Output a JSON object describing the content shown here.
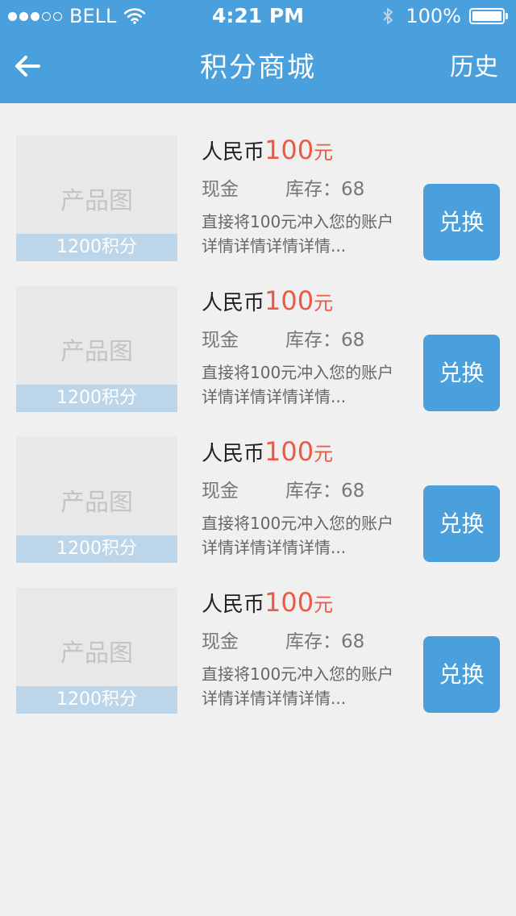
{
  "status_bar": {
    "carrier": "BELL",
    "time": "4:21 PM",
    "battery": "100%"
  },
  "nav": {
    "title": "积分商城",
    "history": "历史"
  },
  "items": [
    {
      "thumb_label": "产品图",
      "points": "1200积分",
      "title": "人民币",
      "price": "100",
      "unit": "元",
      "category": "现金",
      "stock": "库存：68",
      "desc1": "直接将100元冲入您的账户",
      "desc2": "详情详情详情详情...",
      "button": "兑换"
    },
    {
      "thumb_label": "产品图",
      "points": "1200积分",
      "title": "人民币",
      "price": "100",
      "unit": "元",
      "category": "现金",
      "stock": "库存：68",
      "desc1": "直接将100元冲入您的账户",
      "desc2": "详情详情详情详情...",
      "button": "兑换"
    },
    {
      "thumb_label": "产品图",
      "points": "1200积分",
      "title": "人民币",
      "price": "100",
      "unit": "元",
      "category": "现金",
      "stock": "库存：68",
      "desc1": "直接将100元冲入您的账户",
      "desc2": "详情详情详情详情...",
      "button": "兑换"
    },
    {
      "thumb_label": "产品图",
      "points": "1200积分",
      "title": "人民币",
      "price": "100",
      "unit": "元",
      "category": "现金",
      "stock": "库存：68",
      "desc1": "直接将100元冲入您的账户",
      "desc2": "详情详情详情详情...",
      "button": "兑换"
    }
  ],
  "colors": {
    "header": "#4a9fdd",
    "price": "#ea5a45",
    "points_bar": "#bcd5e8",
    "background": "#f0f0f0"
  },
  "icons": {
    "back": "arrow-left-icon",
    "wifi": "wifi-icon",
    "bluetooth": "bluetooth-icon",
    "battery": "battery-icon"
  }
}
